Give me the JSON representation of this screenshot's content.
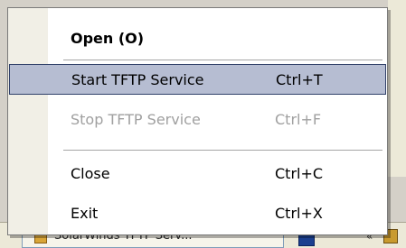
{
  "taskbar": {
    "task_label": "SolarWinds TFTP Serv..."
  },
  "menu": {
    "items": [
      {
        "label": "Open (O)",
        "shortcut": ""
      },
      {
        "label": "Start TFTP Service",
        "shortcut": "Ctrl+T"
      },
      {
        "label": "Stop TFTP Service",
        "shortcut": "Ctrl+F"
      },
      {
        "label": "Close",
        "shortcut": "Ctrl+C"
      },
      {
        "label": "Exit",
        "shortcut": "Ctrl+X"
      }
    ]
  }
}
